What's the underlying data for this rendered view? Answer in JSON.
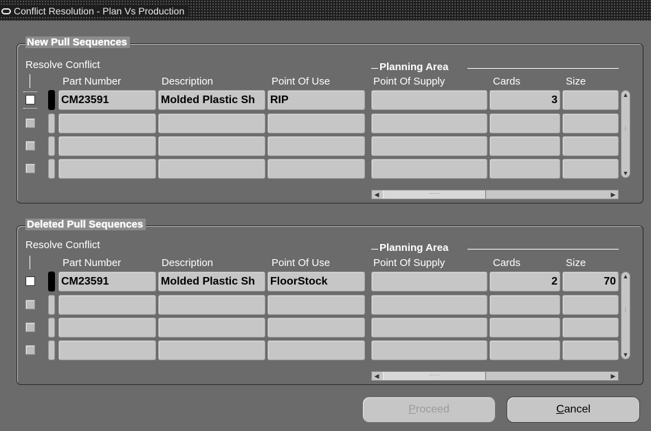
{
  "window": {
    "title": "Conflict Resolution - Plan Vs Production"
  },
  "columns": {
    "resolve_conflict": "Resolve Conflict",
    "part_number": "Part Number",
    "description": "Description",
    "point_of_use": "Point Of Use",
    "planning_area": "Planning Area",
    "point_of_supply": "Point Of Supply",
    "cards": "Cards",
    "size": "Size"
  },
  "new_section": {
    "title": "New Pull Sequences",
    "rows": [
      {
        "checked": false,
        "part_number": "CM23591",
        "description": "Molded Plastic Sh",
        "point_of_use": "RIP",
        "point_of_supply": "",
        "cards": "3",
        "size": ""
      },
      {
        "checked": false,
        "part_number": "",
        "description": "",
        "point_of_use": "",
        "point_of_supply": "",
        "cards": "",
        "size": ""
      },
      {
        "checked": false,
        "part_number": "",
        "description": "",
        "point_of_use": "",
        "point_of_supply": "",
        "cards": "",
        "size": ""
      },
      {
        "checked": false,
        "part_number": "",
        "description": "",
        "point_of_use": "",
        "point_of_supply": "",
        "cards": "",
        "size": ""
      }
    ]
  },
  "deleted_section": {
    "title": "Deleted Pull Sequences",
    "rows": [
      {
        "checked": false,
        "part_number": "CM23591",
        "description": "Molded Plastic Sh",
        "point_of_use": "FloorStock",
        "point_of_supply": "",
        "cards": "2",
        "size": "70"
      },
      {
        "checked": false,
        "part_number": "",
        "description": "",
        "point_of_use": "",
        "point_of_supply": "",
        "cards": "",
        "size": ""
      },
      {
        "checked": false,
        "part_number": "",
        "description": "",
        "point_of_use": "",
        "point_of_supply": "",
        "cards": "",
        "size": ""
      },
      {
        "checked": false,
        "part_number": "",
        "description": "",
        "point_of_use": "",
        "point_of_supply": "",
        "cards": "",
        "size": ""
      }
    ]
  },
  "buttons": {
    "proceed": {
      "label": "Proceed",
      "mnemonic": "P",
      "rest": "roceed",
      "enabled": false
    },
    "cancel": {
      "label": "Cancel",
      "mnemonic": "C",
      "rest": "ancel",
      "enabled": true
    }
  }
}
